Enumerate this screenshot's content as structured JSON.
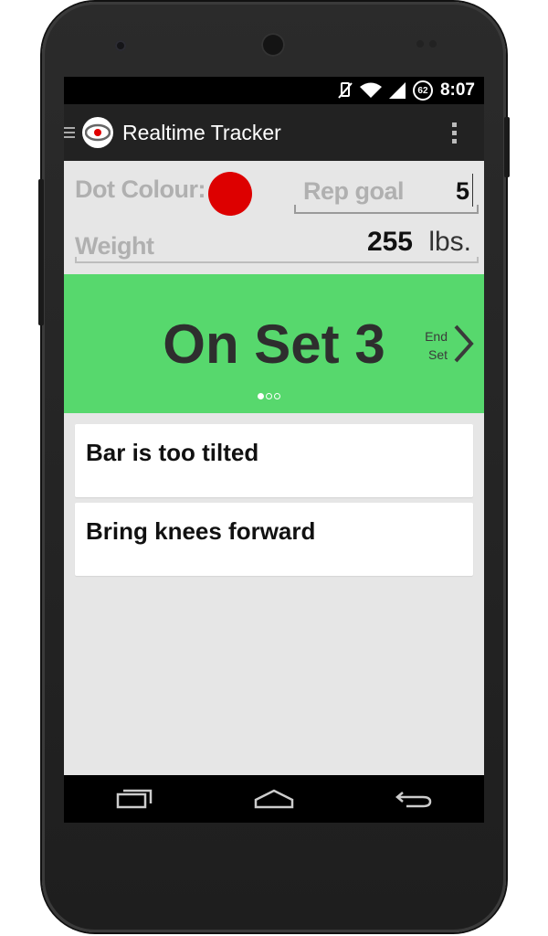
{
  "status_bar": {
    "time": "8:07",
    "battery_level": "62",
    "icons": [
      "vibrate-off-icon",
      "wifi-icon",
      "cell-signal-icon",
      "battery-icon"
    ]
  },
  "action_bar": {
    "title": "Realtime Tracker",
    "logo_icon": "eye-icon",
    "menu_icon": "overflow-menu-icon"
  },
  "settings": {
    "dot_colour_label": "Dot Colour:",
    "dot_colour": "#dd0000",
    "rep_goal_label": "Rep goal",
    "rep_goal_value": "5",
    "weight_label": "Weight",
    "weight_value": "255",
    "weight_unit": "lbs."
  },
  "set_panel": {
    "title": "On Set 3",
    "end_set_line1": "End",
    "end_set_line2": "Set",
    "background_color": "#57d86d",
    "pages_total": 3,
    "page_current": 1
  },
  "feedback": [
    {
      "text": "Bar is too tilted"
    },
    {
      "text": "Bring knees forward"
    }
  ],
  "nav_bar": {
    "buttons": [
      "recent-apps-icon",
      "home-icon",
      "back-icon"
    ]
  }
}
